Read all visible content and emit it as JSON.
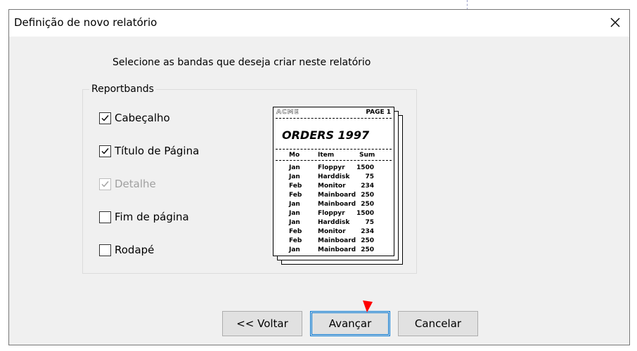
{
  "window": {
    "title": "Definição de novo relatório"
  },
  "instruction": "Selecione as bandas que deseja criar neste relatório",
  "group": {
    "legend": "Reportbands",
    "items": [
      {
        "label": "Cabeçalho",
        "checked": true,
        "enabled": true
      },
      {
        "label": "Título de Página",
        "checked": true,
        "enabled": true
      },
      {
        "label": "Detalhe",
        "checked": true,
        "enabled": false
      },
      {
        "label": "Fim de página",
        "checked": false,
        "enabled": true
      },
      {
        "label": "Rodapé",
        "checked": false,
        "enabled": true
      }
    ]
  },
  "preview": {
    "company": "ACME",
    "page": "PAGE 1",
    "title": "ORDERS 1997",
    "columns": [
      "Mo",
      "Item",
      "Sum"
    ],
    "rows": [
      [
        "Jan",
        "Floppyr",
        "1500"
      ],
      [
        "Jan",
        "Harddisk",
        "75"
      ],
      [
        "Feb",
        "Monitor",
        "234"
      ],
      [
        "Feb",
        "Mainboard",
        "250"
      ],
      [
        "Jan",
        "Mainboard",
        "250"
      ],
      [
        "Jan",
        "Floppyr",
        "1500"
      ],
      [
        "Jan",
        "Harddisk",
        "75"
      ],
      [
        "Feb",
        "Monitor",
        "234"
      ],
      [
        "Feb",
        "Mainboard",
        "250"
      ],
      [
        "Jan",
        "Mainboard",
        "250"
      ]
    ]
  },
  "buttons": {
    "back": "<< Voltar",
    "next": "Avançar",
    "cancel": "Cancelar"
  },
  "colors": {
    "dialog_bg": "#f0f0f0",
    "titlebar_bg": "#ffffff",
    "default_button_border": "#0078d7",
    "cursor": "#ff0000"
  },
  "icons": {
    "close": "close-icon",
    "check": "checkmark-icon",
    "cursor": "mouse-cursor-icon"
  }
}
